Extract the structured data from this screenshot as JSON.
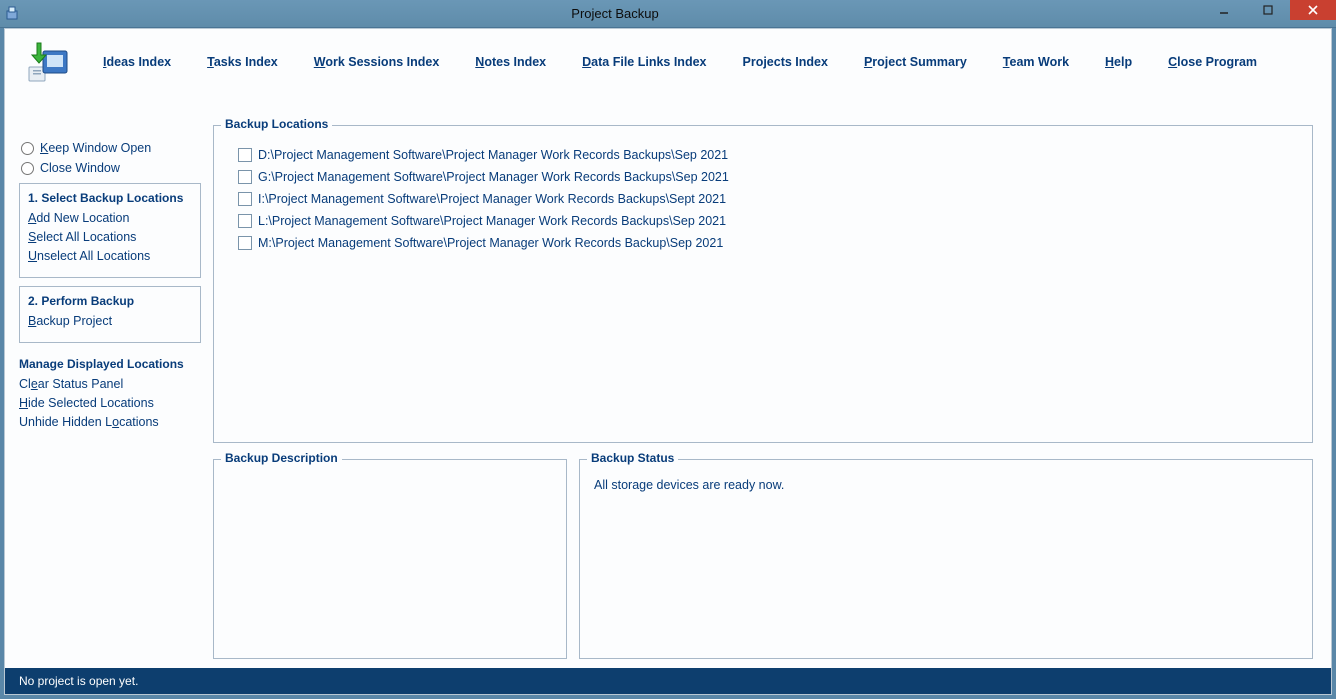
{
  "window": {
    "title": "Project Backup"
  },
  "menu": [
    {
      "label": "Ideas Index",
      "accel": 0
    },
    {
      "label": "Tasks Index",
      "accel": 0
    },
    {
      "label": "Work Sessions Index",
      "accel": 0
    },
    {
      "label": "Notes Index",
      "accel": 0
    },
    {
      "label": "Data File Links Index",
      "accel": 0
    },
    {
      "label": "Projects Index",
      "accel": -1
    },
    {
      "label": "Project Summary",
      "accel": 0
    },
    {
      "label": "Team Work",
      "accel": 0
    },
    {
      "label": "Help",
      "accel": 0
    },
    {
      "label": "Close Program",
      "accel": 0
    }
  ],
  "sidebar": {
    "keep_window_open": "Keep Window Open",
    "close_window": "Close Window",
    "group1": {
      "header": "1. Select Backup Locations",
      "add": "Add New Location",
      "select_all": "Select All Locations",
      "unselect_all": "Unselect All Locations"
    },
    "group2": {
      "header": "2. Perform Backup",
      "backup_project": "Backup Project"
    },
    "manage": {
      "header": "Manage Displayed Locations",
      "clear_status": "Clear Status Panel",
      "hide_selected": "Hide Selected Locations",
      "unhide_hidden": "Unhide Hidden Locations"
    }
  },
  "locations": {
    "legend": "Backup Locations",
    "items": [
      "D:\\Project Management Software\\Project Manager Work Records Backups\\Sep 2021",
      "G:\\Project Management Software\\Project Manager Work Records Backups\\Sep 2021",
      "I:\\Project Management Software\\Project Manager Work Records Backups\\Sept 2021",
      "L:\\Project Management Software\\Project Manager Work Records Backups\\Sep 2021",
      "M:\\Project Management Software\\Project Manager Work Records Backup\\Sep 2021"
    ]
  },
  "description": {
    "legend": "Backup Description"
  },
  "status": {
    "legend": "Backup Status",
    "message": "All storage devices are ready now."
  },
  "statusbar": "No project is open yet."
}
